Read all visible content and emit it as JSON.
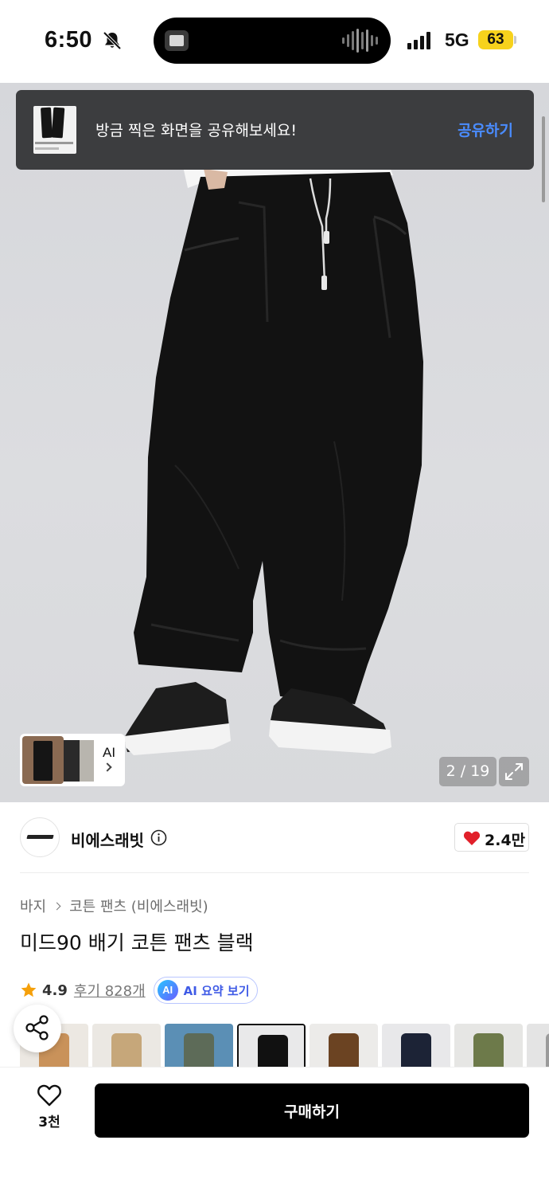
{
  "status_bar": {
    "time": "6:50",
    "network": "5G",
    "battery": "63",
    "icons": [
      "bell-off-icon",
      "signal-icon"
    ]
  },
  "share_banner": {
    "message": "방금 찍은 화면을 공유해보세요!",
    "action": "공유하기"
  },
  "gallery": {
    "ai_label": "AI",
    "counter": "2 / 19",
    "expand_icon": "expand-icon"
  },
  "brand": {
    "name": "비에스래빗",
    "likes": "2.4만"
  },
  "product": {
    "breadcrumb": [
      "바지",
      "코튼 팬츠 (비에스래빗)"
    ],
    "title": "미드90 배기 코튼 팬츠 블랙",
    "rating": "4.9",
    "reviews": "후기 828개",
    "ai_summary_badge": "AI",
    "ai_summary": "AI 요약 보기"
  },
  "colors": {
    "swatches": [
      {
        "bg": "#ece8e2",
        "pant": "#c9925a"
      },
      {
        "bg": "#ebe8e3",
        "pant": "#c6a77a"
      },
      {
        "bg": "#5b8fb5",
        "pant": "#5d6b58"
      },
      {
        "bg": "#e9e9ea",
        "pant": "#111111",
        "selected": true
      },
      {
        "bg": "#ecebe9",
        "pant": "#6b4322"
      },
      {
        "bg": "#e8e8ea",
        "pant": "#1c2336"
      },
      {
        "bg": "#e6e6e4",
        "pant": "#6d7a4a"
      },
      {
        "bg": "#e4e4e4",
        "pant": "#9a9a9a"
      }
    ]
  },
  "bottom": {
    "wish_count": "3천",
    "buy_label": "구매하기"
  },
  "accent": {
    "like_red": "#e1202a",
    "link_blue": "#4a8cff",
    "ai_purple": "#3f5be6"
  }
}
